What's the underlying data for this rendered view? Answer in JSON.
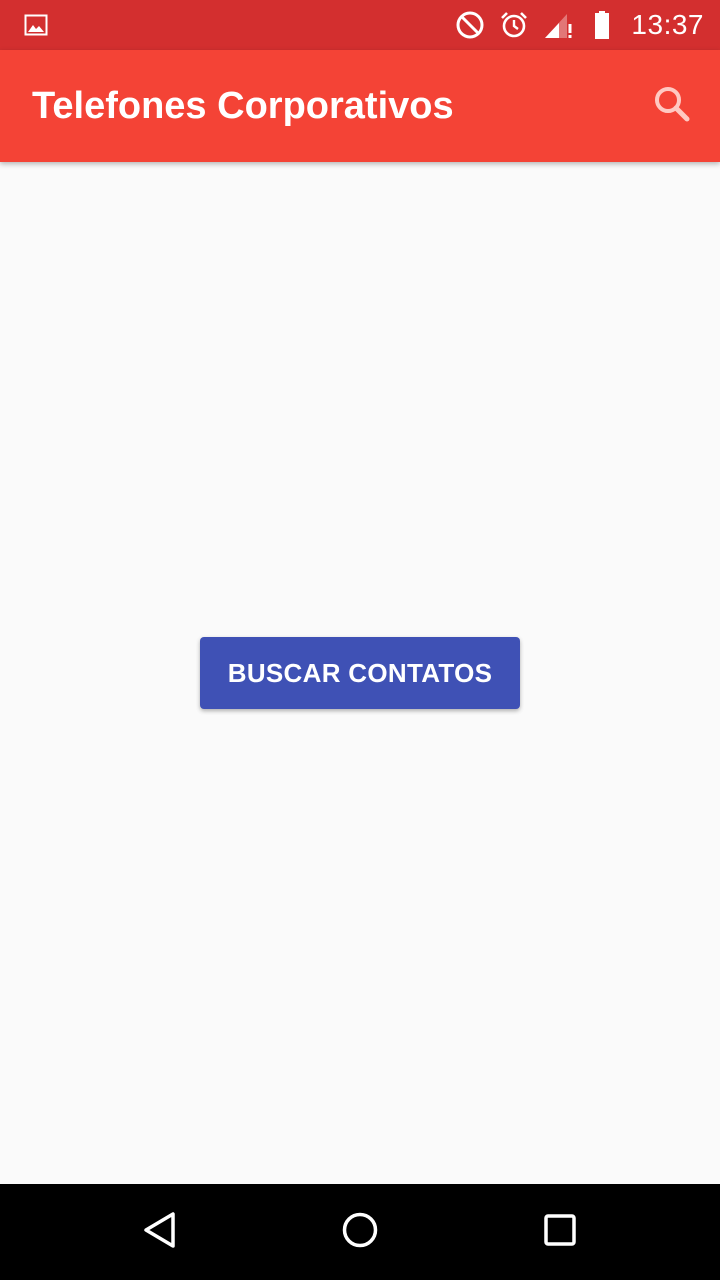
{
  "status_bar": {
    "time": "13:37",
    "icons": [
      "image-icon",
      "do-not-disturb-icon",
      "alarm-icon",
      "signal-icon",
      "battery-icon"
    ]
  },
  "app_bar": {
    "title": "Telefones Corporativos",
    "search_icon": "search-icon"
  },
  "main": {
    "button_label": "BUSCAR CONTATOS"
  },
  "nav_bar": {
    "icons": [
      "back-icon",
      "home-icon",
      "recent-apps-icon"
    ]
  },
  "colors": {
    "status_bar": "#d32f2f",
    "app_bar": "#f44336",
    "button": "#3f51b5",
    "background": "#fafafa",
    "nav_bar": "#000000"
  }
}
